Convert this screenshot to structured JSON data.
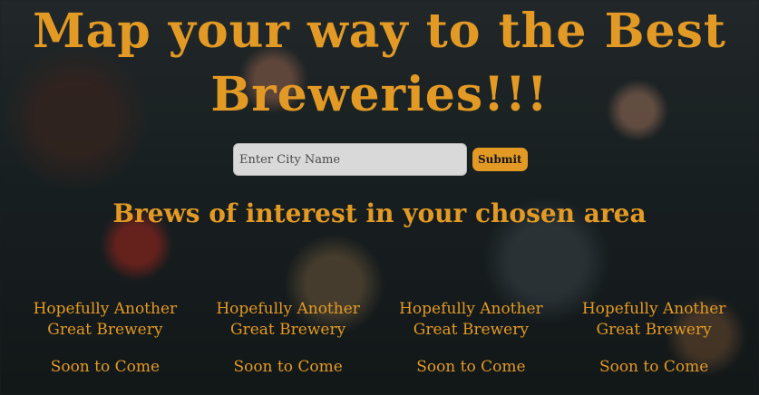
{
  "header": {
    "title": "Map your way to the Best Breweries!!!"
  },
  "search": {
    "placeholder": "Enter City Name",
    "value": "",
    "submit_label": "Submit"
  },
  "results": {
    "heading": "Brews of interest in your chosen area",
    "cards": [
      {
        "name": "Hopefully Another Great Brewery",
        "status": "Soon to Come"
      },
      {
        "name": "Hopefully Another Great Brewery",
        "status": "Soon to Come"
      },
      {
        "name": "Hopefully Another Great Brewery",
        "status": "Soon to Come"
      },
      {
        "name": "Hopefully Another Great Brewery",
        "status": "Soon to Come"
      }
    ]
  },
  "colors": {
    "accent": "#e39a25",
    "input_bg": "#d9d9d9"
  }
}
